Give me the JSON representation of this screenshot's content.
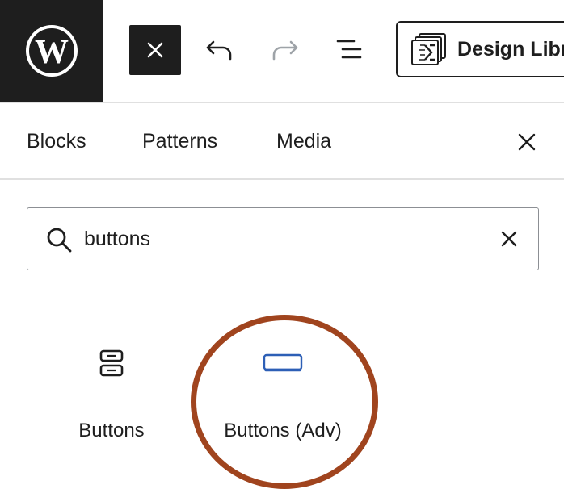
{
  "toolbar": {
    "logo_icon": "wordpress-icon",
    "close_icon": "close-icon",
    "undo_icon": "undo-icon",
    "redo_icon": "redo-icon",
    "list_view_icon": "list-view-icon",
    "design_library_label": "Design Libr"
  },
  "tabs": [
    {
      "label": "Blocks",
      "active": true
    },
    {
      "label": "Patterns",
      "active": false
    },
    {
      "label": "Media",
      "active": false
    }
  ],
  "search": {
    "value": "buttons",
    "placeholder": "Search"
  },
  "results": [
    {
      "label": "Buttons",
      "icon": "buttons-icon"
    },
    {
      "label": "Buttons (Adv)",
      "icon": "buttons-adv-icon"
    }
  ],
  "colors": {
    "accent": "#3858e9",
    "dark": "#1e1e1e",
    "highlight_circle": "#a0441e",
    "adv_icon": "#2d5fb6"
  }
}
